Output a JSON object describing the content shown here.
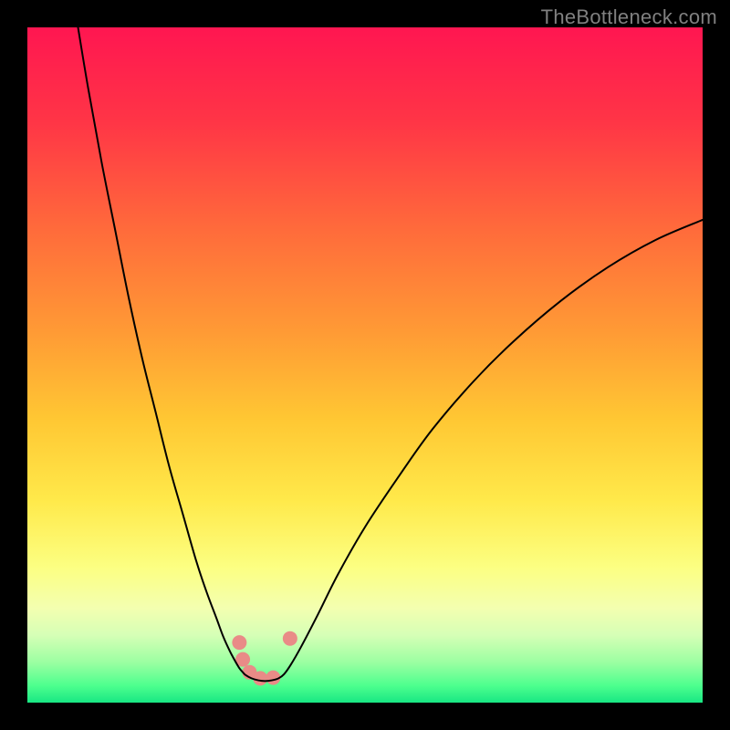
{
  "watermark": "TheBottleneck.com",
  "chart_data": {
    "type": "line",
    "title": "",
    "xlabel": "",
    "ylabel": "",
    "xlim": [
      0,
      100
    ],
    "ylim": [
      0,
      100
    ],
    "grid": false,
    "legend": false,
    "notes": "No axes, ticks, or labels are rendered. x/y values are estimated from pixel positions as percentages of the plot area (0-100). Background is a vertical gradient from red (top) through orange/yellow to green (bottom).",
    "background_gradient_stops": [
      {
        "t": 0.0,
        "color": "#ff1651"
      },
      {
        "t": 0.14,
        "color": "#ff3546"
      },
      {
        "t": 0.3,
        "color": "#ff6b3b"
      },
      {
        "t": 0.45,
        "color": "#ff9a35"
      },
      {
        "t": 0.58,
        "color": "#ffc733"
      },
      {
        "t": 0.7,
        "color": "#ffe94a"
      },
      {
        "t": 0.8,
        "color": "#fcff82"
      },
      {
        "t": 0.86,
        "color": "#f3ffb0"
      },
      {
        "t": 0.9,
        "color": "#d6ffb6"
      },
      {
        "t": 0.94,
        "color": "#9cffa2"
      },
      {
        "t": 0.975,
        "color": "#4dff8e"
      },
      {
        "t": 1.0,
        "color": "#18e783"
      }
    ],
    "series": [
      {
        "name": "curve-left",
        "stroke": "#000000",
        "x": [
          7.5,
          9,
          11,
          13,
          15,
          17,
          19,
          21,
          23,
          25,
          26.5,
          28,
          29,
          30,
          30.8,
          31.4,
          31.9,
          32.3
        ],
        "y": [
          100,
          91,
          80,
          70,
          60,
          51,
          43,
          35,
          28,
          21,
          16.5,
          12.5,
          9.8,
          7.6,
          6.1,
          5.1,
          4.5,
          4.1
        ]
      },
      {
        "name": "valley-floor",
        "stroke": "#000000",
        "x": [
          32.3,
          33.2,
          34.2,
          35.2,
          36.2,
          37.2,
          38.0
        ],
        "y": [
          4.1,
          3.6,
          3.3,
          3.2,
          3.3,
          3.6,
          4.2
        ]
      },
      {
        "name": "curve-right",
        "stroke": "#000000",
        "x": [
          38.0,
          39.0,
          40.5,
          43,
          46,
          50,
          55,
          60,
          66,
          72,
          79,
          86,
          93,
          100
        ],
        "y": [
          4.2,
          5.6,
          8.2,
          13,
          19,
          26,
          33.5,
          40.5,
          47.5,
          53.5,
          59.5,
          64.5,
          68.5,
          71.5
        ]
      }
    ],
    "markers": [
      {
        "x": 31.4,
        "y": 8.9,
        "r": 8,
        "color": "#e98b87"
      },
      {
        "x": 31.9,
        "y": 6.4,
        "r": 8,
        "color": "#e98b87"
      },
      {
        "x": 32.9,
        "y": 4.5,
        "r": 8,
        "color": "#e98b87"
      },
      {
        "x": 34.5,
        "y": 3.6,
        "r": 8,
        "color": "#e98b87"
      },
      {
        "x": 36.4,
        "y": 3.7,
        "r": 8,
        "color": "#e98b87"
      },
      {
        "x": 38.9,
        "y": 9.5,
        "r": 8,
        "color": "#e98b87"
      }
    ]
  }
}
